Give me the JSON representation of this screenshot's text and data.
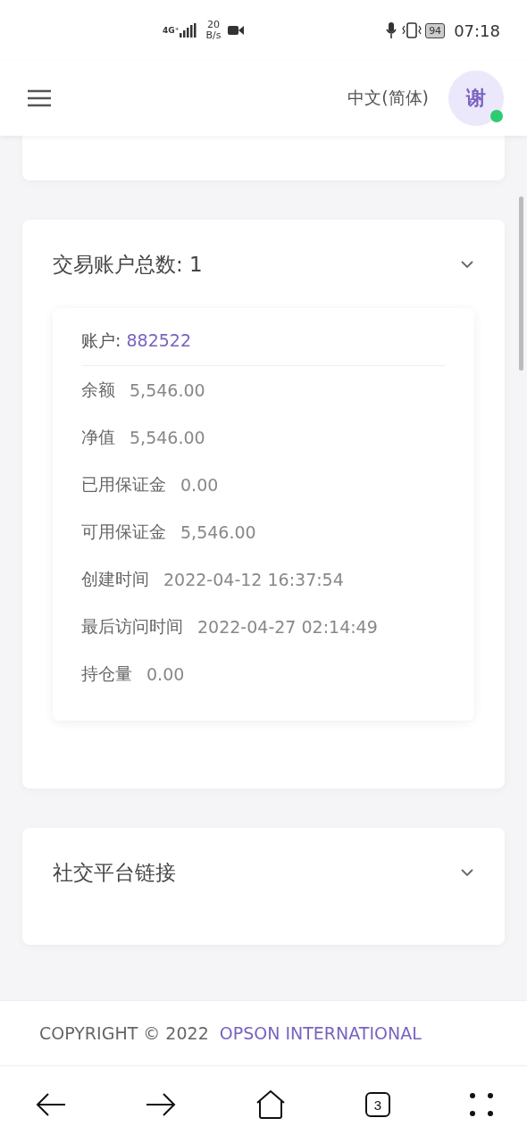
{
  "status_bar": {
    "network": "4G⁺",
    "speed_value": "20",
    "speed_unit": "B/s",
    "battery": "94",
    "time": "07:18"
  },
  "header": {
    "language": "中文(简体)",
    "avatar": "谢",
    "online": true
  },
  "accounts_card": {
    "title": "交易账户总数: 1",
    "account": {
      "label": "账户: ",
      "number": "882522",
      "fields": [
        {
          "label": "余额",
          "value": "5,546.00"
        },
        {
          "label": "净值",
          "value": "5,546.00"
        },
        {
          "label": "已用保证金",
          "value": "0.00"
        },
        {
          "label": "可用保证金",
          "value": "5,546.00"
        },
        {
          "label": "创建时间",
          "value": "2022-04-12 16:37:54"
        },
        {
          "label": "最后访问时间",
          "value": "2022-04-27 02:14:49"
        },
        {
          "label": "持仓量",
          "value": "0.00"
        }
      ]
    }
  },
  "social_card": {
    "title": "社交平台链接"
  },
  "footer": {
    "copyright": "COPYRIGHT © 2022",
    "company": "OPSON INTERNATIONAL"
  },
  "browser_nav": {
    "tabs_count": "3"
  }
}
